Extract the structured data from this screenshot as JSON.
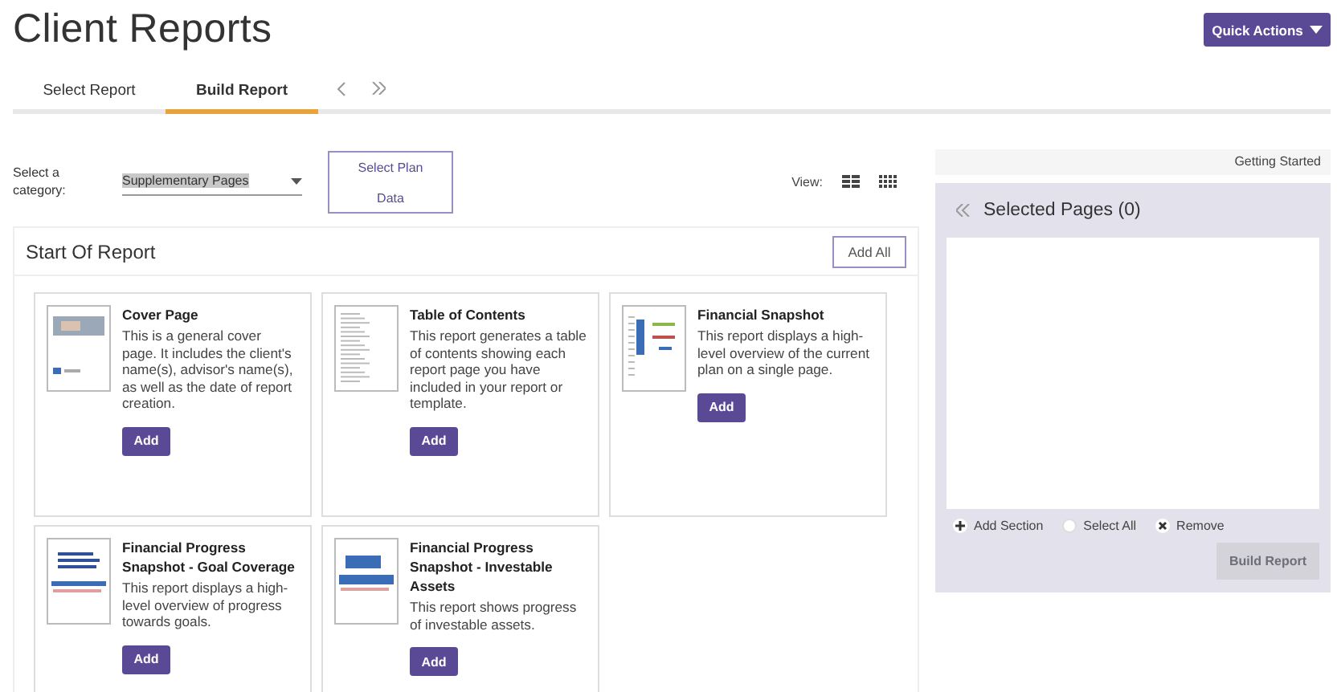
{
  "title": "Client Reports",
  "quick_actions": {
    "label": "Quick Actions"
  },
  "tabs": [
    {
      "label": "Select Report",
      "selected": false
    },
    {
      "label": "Build Report",
      "selected": true
    }
  ],
  "category": {
    "label": "Select a category:",
    "value": "Supplementary Pages"
  },
  "select_plan_button": {
    "label": "Select Plan Data"
  },
  "view": {
    "label": "View:"
  },
  "section": {
    "title": "Start Of Report",
    "add_all": "Add All"
  },
  "cards": [
    {
      "kind": "cover",
      "title": "Cover Page",
      "description": "This is a general cover page. It includes the client's name(s), advisor's name(s), as well as the date of report creation.",
      "button": "Add"
    },
    {
      "kind": "list",
      "title": "Table of Contents",
      "description": "This report generates a table of contents showing each report page you have included in your report or template.",
      "button": "Add"
    },
    {
      "kind": "snapshot",
      "title": "Financial Snapshot",
      "description": "This report displays a high-level overview of the current plan on a single page.",
      "button": "Add"
    },
    {
      "kind": "bars",
      "title": "Financial Progress Snapshot - Goal Coverage",
      "description": "This report displays a high-level overview of progress towards goals.",
      "button": "Add"
    },
    {
      "kind": "area",
      "title": "Financial Progress Snapshot - Investable Assets",
      "description": "This report shows progress of investable assets.",
      "button": "Add"
    }
  ],
  "getting_started": "Getting Started",
  "selected_pages": {
    "title": "Selected Pages (0)"
  },
  "actions": [
    {
      "kind": "add",
      "label": "Add Section"
    },
    {
      "kind": "select",
      "label": "Select All"
    },
    {
      "kind": "remove",
      "label": "Remove"
    }
  ],
  "build_report": {
    "label": "Build Report",
    "disabled": true
  }
}
